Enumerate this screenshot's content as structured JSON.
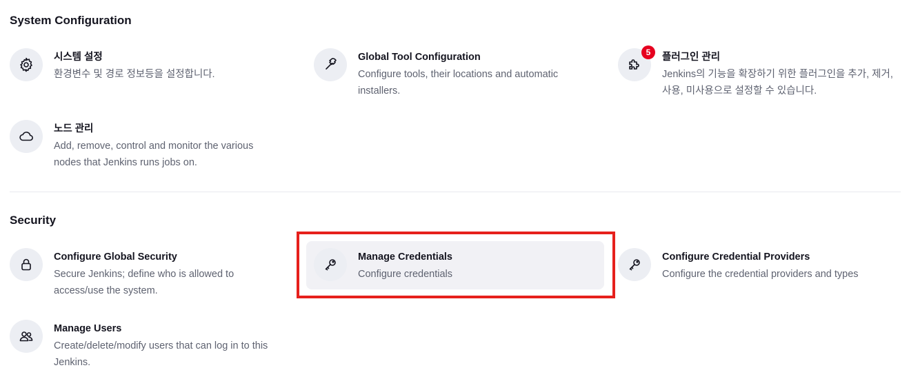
{
  "sections": {
    "system": {
      "title": "System Configuration"
    },
    "security": {
      "title": "Security"
    }
  },
  "tiles": {
    "system_settings": {
      "title": "시스템 설정",
      "desc": "환경변수 및 경로 정보등을 설정합니다.",
      "icon": "gear-icon"
    },
    "global_tool": {
      "title": "Global Tool Configuration",
      "desc": "Configure tools, their locations and automatic installers.",
      "icon": "hammer-icon"
    },
    "plugins": {
      "title": "플러그인 관리",
      "desc": "Jenkins의 기능을 확장하기 위한 플러그인을 추가, 제거, 사용, 미사용으로 설정할 수 있습니다.",
      "icon": "puzzle-icon",
      "badge": "5"
    },
    "nodes": {
      "title": "노드 관리",
      "desc": "Add, remove, control and monitor the various nodes that Jenkins runs jobs on.",
      "icon": "cloud-icon"
    },
    "global_security": {
      "title": "Configure Global Security",
      "desc": "Secure Jenkins; define who is allowed to access/use the system.",
      "icon": "lock-icon"
    },
    "manage_credentials": {
      "title": "Manage Credentials",
      "desc": "Configure credentials",
      "icon": "key-icon"
    },
    "credential_providers": {
      "title": "Configure Credential Providers",
      "desc": "Configure the credential providers and types",
      "icon": "key-icon"
    },
    "manage_users": {
      "title": "Manage Users",
      "desc": "Create/delete/modify users that can log in to this Jenkins.",
      "icon": "users-icon"
    }
  },
  "colors": {
    "badge": "#e6001f",
    "highlight_border": "#e6201c",
    "icon_bg": "#eceef3"
  }
}
